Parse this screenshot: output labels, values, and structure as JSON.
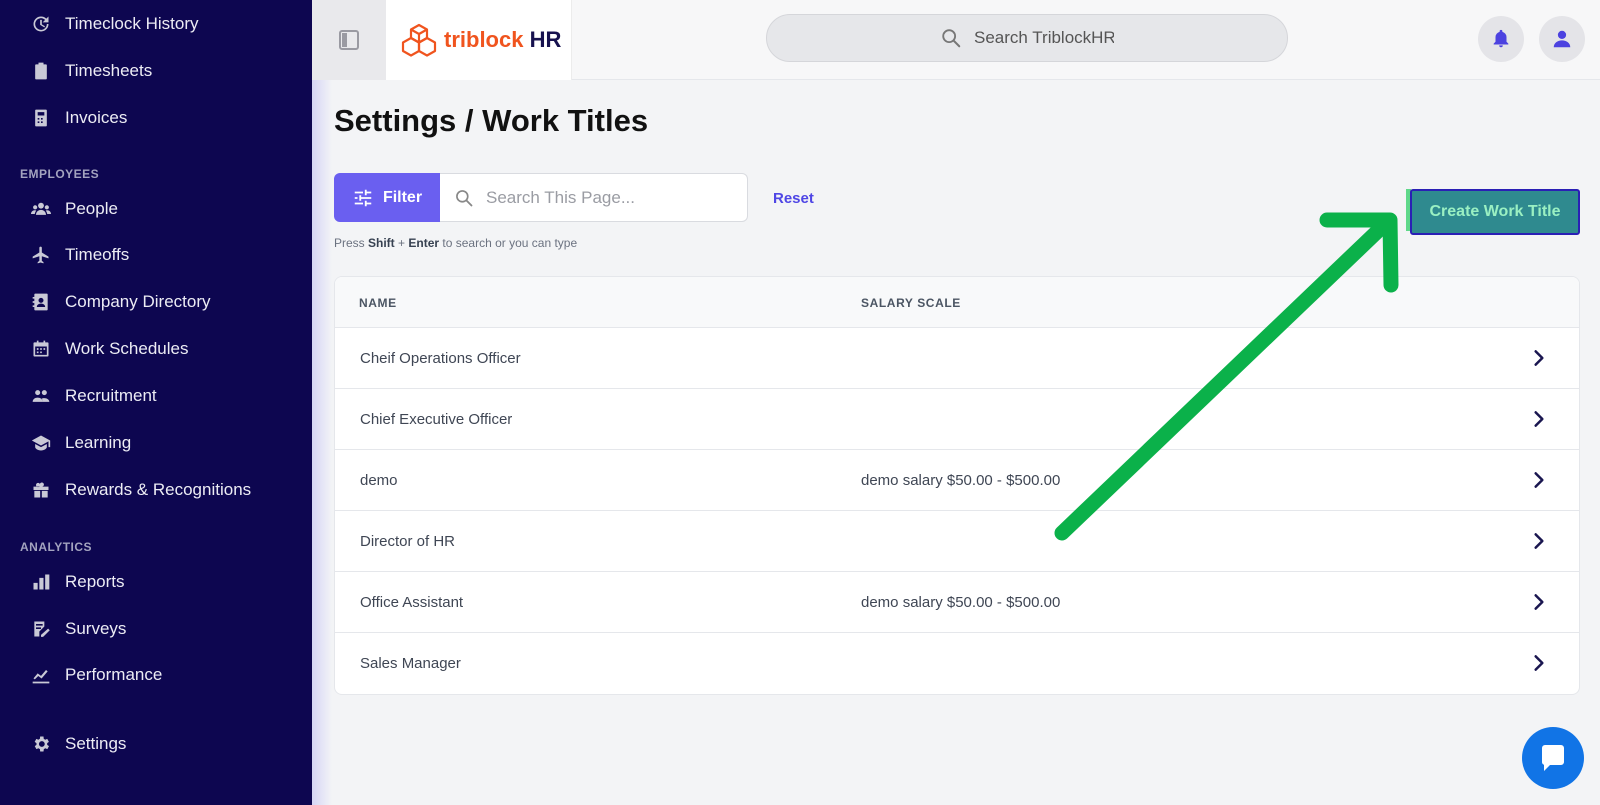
{
  "sidebar": {
    "items_top": [
      {
        "label": "Timeclock History",
        "icon": "clock-history-icon"
      },
      {
        "label": "Timesheets",
        "icon": "clipboard-icon"
      },
      {
        "label": "Invoices",
        "icon": "calculator-icon"
      }
    ],
    "section_employees": "EMPLOYEES",
    "items_employees": [
      {
        "label": "People",
        "icon": "people-icon"
      },
      {
        "label": "Timeoffs",
        "icon": "plane-icon"
      },
      {
        "label": "Company Directory",
        "icon": "contact-book-icon"
      },
      {
        "label": "Work Schedules",
        "icon": "calendar-icon"
      },
      {
        "label": "Recruitment",
        "icon": "user-group-icon"
      },
      {
        "label": "Learning",
        "icon": "graduation-cap-icon"
      },
      {
        "label": "Rewards & Recognitions",
        "icon": "gift-icon"
      }
    ],
    "section_analytics": "ANALYTICS",
    "items_analytics": [
      {
        "label": "Reports",
        "icon": "bar-chart-icon"
      },
      {
        "label": "Surveys",
        "icon": "survey-edit-icon"
      },
      {
        "label": "Performance",
        "icon": "trend-line-icon"
      }
    ],
    "settings": {
      "label": "Settings",
      "icon": "gear-icon"
    }
  },
  "header": {
    "logo_part1": "triblock",
    "logo_part2": "HR",
    "search_placeholder": "Search TriblockHR"
  },
  "page": {
    "title": "Settings / Work Titles",
    "filter_label": "Filter",
    "search_placeholder": "Search This Page...",
    "reset_label": "Reset",
    "hint_prefix": "Press ",
    "hint_key1": "Shift",
    "hint_plus": " + ",
    "hint_key2": "Enter",
    "hint_suffix": " to search or you can type",
    "create_button": "Create Work Title"
  },
  "table": {
    "columns": [
      "NAME",
      "SALARY SCALE"
    ],
    "rows": [
      {
        "name": "Cheif Operations Officer",
        "salary": ""
      },
      {
        "name": "Chief Executive Officer",
        "salary": ""
      },
      {
        "name": "demo",
        "salary": "demo salary $50.00 - $500.00"
      },
      {
        "name": "Director of HR",
        "salary": ""
      },
      {
        "name": "Office Assistant",
        "salary": "demo salary $50.00 - $500.00"
      },
      {
        "name": "Sales Manager",
        "salary": ""
      }
    ]
  },
  "colors": {
    "sidebar_bg": "#0d0650",
    "accent": "#6a5ff0",
    "logo_orange": "#f0541e",
    "annotation_arrow": "#0bb14a",
    "chat": "#1174e6"
  }
}
